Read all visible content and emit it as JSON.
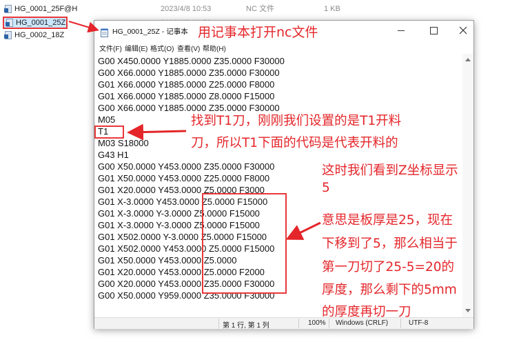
{
  "explorer": {
    "files": [
      {
        "name": "HG_0001_25F@H",
        "date": "2023/4/8 10:53",
        "type": "NC 文件",
        "size": "1 KB"
      },
      {
        "name": "HG_0001_25Z",
        "date": "2023/4/8 10:53",
        "type": "NC 文件",
        "size": "1 KB"
      },
      {
        "name": "HG_0002_18Z",
        "date": "",
        "type": "",
        "size": ""
      }
    ]
  },
  "notepad": {
    "title": "HG_0001_25Z - 记事本",
    "menu": [
      "文件(F)",
      "编辑(E)",
      "格式(O)",
      "查看(V)",
      "帮助(H)"
    ],
    "lines": [
      "G00 X450.0000 Y1885.0000 Z35.0000 F30000",
      "G00 X66.0000 Y1885.0000 Z35.0000 F30000",
      "G01 X66.0000 Y1885.0000 Z25.0000 F8000",
      "G01 X66.0000 Y1885.0000 Z8.0000 F15000",
      "G00 X66.0000 Y1885.0000 Z35.0000 F30000",
      "M05",
      "T1",
      "M03 S18000",
      "G43 H1",
      "G00 X50.0000 Y453.0000 Z35.0000 F30000",
      "G01 X50.0000 Y453.0000 Z25.0000 F8000",
      "G01 X20.0000 Y453.0000 Z5.0000 F3000",
      "G01 X-3.0000 Y453.0000 Z5.0000 F15000",
      "G01 X-3.0000 Y-3.0000 Z5.0000 F15000",
      "G01 X-3.0000 Y-3.0000 Z5.0000 F15000",
      "G01 X502.0000 Y-3.0000 Z5.0000 F15000",
      "G01 X502.0000 Y453.0000 Z5.0000 F15000",
      "G01 X50.0000 Y453.0000 Z5.0000",
      "G01 X20.0000 Y453.0000 Z5.0000 F2000",
      "G00 X20.0000 Y453.0000 Z35.0000 F30000",
      "G00 X50.0000 Y959.0000 Z35.0000 F30000"
    ],
    "status": {
      "position": "第 1 行, 第 1 列",
      "zoom": "100%",
      "eol": "Windows (CRLF)",
      "encoding": "UTF-8"
    }
  },
  "annotations": {
    "open_hint": "用记事本打开nc文件",
    "t1_line1": "找到T1刀，刚刚我们设置的是T1开料",
    "t1_line2": "刀，所以T1下面的代码是代表开料的",
    "z_lines": [
      "这时我们看到Z坐标显示",
      "5",
      "意思是板厚是25，现在",
      "下移到了5，那么相当于",
      "第一刀切了25-5=20的",
      "厚度，那么剩下的5mm",
      "的厚度再切一刀"
    ]
  },
  "colors": {
    "annotation": "#e4262a",
    "selection": "#cce8ff"
  }
}
